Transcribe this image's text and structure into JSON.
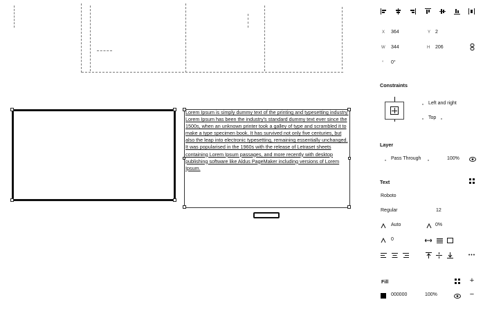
{
  "canvas": {
    "lorem_text": "Lorem Ipsum is simply dummy text of the printing and typesetting industry. Lorem Ipsum has been the industry's standard dummy text ever since the 1500s, when an unknown printer took a galley of type and scrambled it to make a type specimen book. It has survived not only five centuries, but also the leap into electronic typesetting, remaining essentially unchanged. It was popularised in the 1960s with the release of Letraset sheets containing Lorem Ipsum passages, and more recently with desktop publishing software like Aldus PageMaker including versions of Lorem Ipsum."
  },
  "inspector": {
    "align_icons": [
      "align-left-icon",
      "align-center-h-icon",
      "align-right-icon",
      "align-top-icon",
      "align-middle-v-icon",
      "align-bottom-icon"
    ],
    "position": {
      "x_label": "X",
      "x_value": "364",
      "y_label": "Y",
      "y_value": "2",
      "w_label": "W",
      "w_value": "344",
      "h_label": "H",
      "h_value": "206",
      "rotation_label": "°",
      "rotation_value": "0°"
    },
    "constraints": {
      "title": "Constraints",
      "horizontal": "Left and right",
      "vertical": "Top"
    },
    "layer": {
      "title": "Layer",
      "blend_mode": "Pass Through",
      "opacity": "100%"
    },
    "text": {
      "title": "Text",
      "font_family": "Roboto",
      "font_weight": "Regular",
      "font_size": "12",
      "line_height": "Auto",
      "letter_spacing": "0%",
      "paragraph_spacing": "0"
    },
    "fill": {
      "title": "Fill",
      "color_hex": "000000",
      "opacity": "100%",
      "swatch_color": "#000000"
    }
  }
}
